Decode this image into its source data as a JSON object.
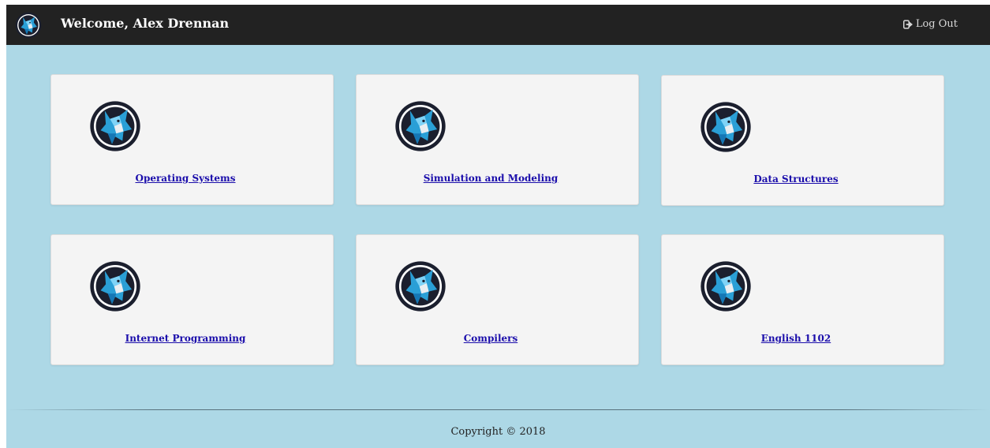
{
  "header": {
    "welcome": "Welcome, Alex Drennan",
    "logout_label": "Log Out",
    "logo_icon": "wolf-logo-icon",
    "logout_icon": "sign-out-icon"
  },
  "courses": [
    {
      "label": "Operating Systems"
    },
    {
      "label": "Simulation and Modeling"
    },
    {
      "label": "Data Structures"
    },
    {
      "label": "Internet Programming"
    },
    {
      "label": "Compilers"
    },
    {
      "label": "English 1102"
    }
  ],
  "footer": {
    "copyright": "Copyright © 2018"
  },
  "colors": {
    "background": "#add8e6",
    "header_bg": "#222222",
    "card_bg": "#f4f4f4",
    "link": "#1a0dab",
    "logo_blue": "#2a9fd6",
    "logo_dark": "#1b1f2e"
  }
}
